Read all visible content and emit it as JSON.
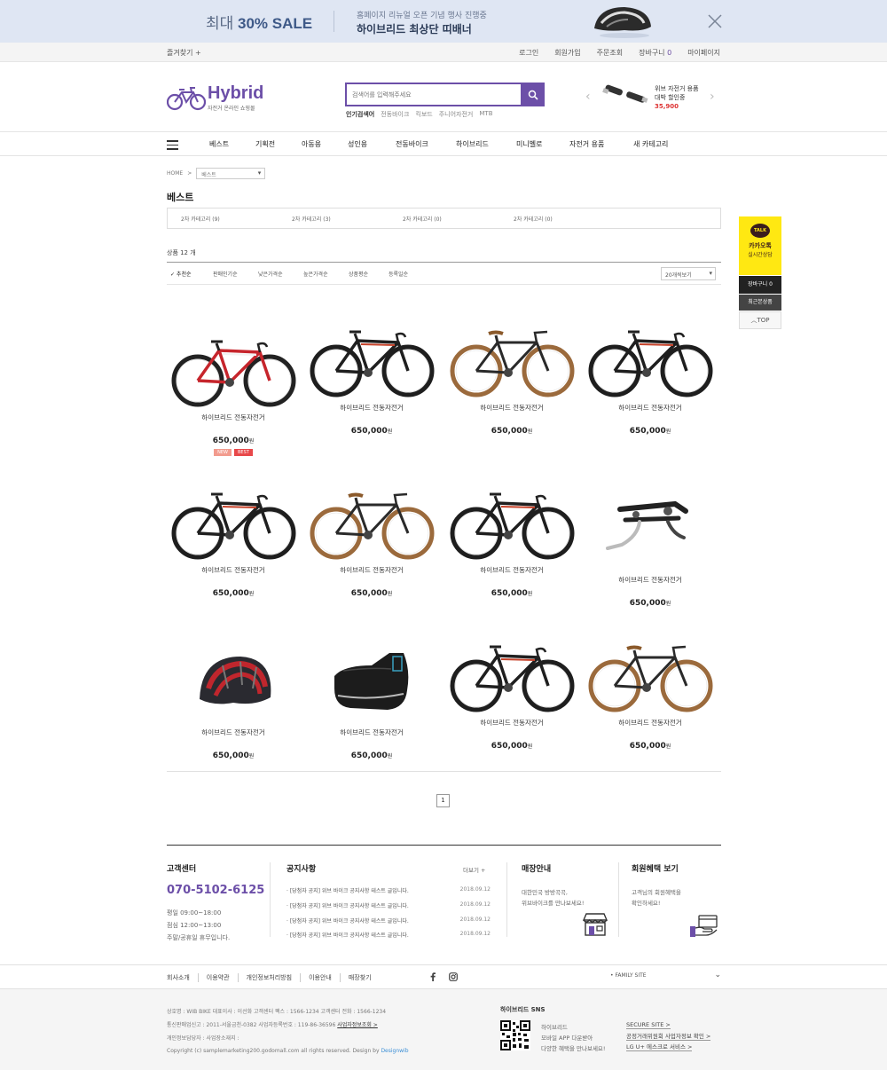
{
  "banner": {
    "sale_prefix": "최대",
    "sale_main": "30% SALE",
    "line1": "홈페이지 리뉴얼 오픈 기념 행사 진행중",
    "line2": "하이브리드 최상단 띠배너"
  },
  "util": {
    "favorite": "즐겨찾기 +",
    "links": [
      "로그인",
      "회원가입",
      "주문조회",
      "장바구니",
      "마이페이지"
    ],
    "cart_count": "0"
  },
  "header": {
    "logo_title": "Hybrid",
    "logo_sub": "자전거 온라인 쇼핑몰",
    "search_placeholder": "검색어를 입력해주세요",
    "popular_label": "인기검색어",
    "popular_items": [
      "전동바이크",
      "킥보드",
      "주니어자전거",
      "MTB"
    ],
    "ad_line1": "위브 자전거 용품",
    "ad_line2": "대박 할인중",
    "ad_price": "35,900"
  },
  "gnb": [
    "베스트",
    "기획전",
    "아동용",
    "성인용",
    "전동바이크",
    "하이브리드",
    "미니벨로",
    "자전거 용품",
    "새 카테고리"
  ],
  "breadcrumb": {
    "home": "HOME",
    "sep": ">",
    "current": "베스트"
  },
  "page_title": "베스트",
  "subcategories": [
    "2차 카테고리 (9)",
    "2차 카테고리 (3)",
    "2차 카테고리 (0)",
    "2차 카테고리 (0)"
  ],
  "product_count": "상품 12 개",
  "sort_options": [
    "✓ 추천순",
    "판매인기순",
    "낮은가격순",
    "높은가격순",
    "상품평순",
    "등록일순"
  ],
  "per_page": "20개씩보기",
  "products": [
    {
      "name": "하이브리드 전동자전거",
      "price": "650,000",
      "unit": "원",
      "image": "road-bike-red-white",
      "badges": [
        "NEW",
        "BEST"
      ]
    },
    {
      "name": "하이브리드 전동자전거",
      "price": "650,000",
      "unit": "원",
      "image": "road-bike-black-red"
    },
    {
      "name": "하이브리드 전동자전거",
      "price": "650,000",
      "unit": "원",
      "image": "city-bike-brown"
    },
    {
      "name": "하이브리드 전동자전거",
      "price": "650,000",
      "unit": "원",
      "image": "road-bike-black-red"
    },
    {
      "name": "하이브리드 전동자전거",
      "price": "650,000",
      "unit": "원",
      "image": "road-bike-black-red"
    },
    {
      "name": "하이브리드 전동자전거",
      "price": "650,000",
      "unit": "원",
      "image": "city-bike-brown"
    },
    {
      "name": "하이브리드 전동자전거",
      "price": "650,000",
      "unit": "원",
      "image": "road-bike-black-red"
    },
    {
      "name": "하이브리드 전동자전거",
      "price": "650,000",
      "unit": "원",
      "image": "aero-handlebar"
    },
    {
      "name": "하이브리드 전동자전거",
      "price": "650,000",
      "unit": "원",
      "image": "helmet"
    },
    {
      "name": "하이브리드 전동자전거",
      "price": "650,000",
      "unit": "원",
      "image": "saddle-bag"
    },
    {
      "name": "하이브리드 전동자전거",
      "price": "650,000",
      "unit": "원",
      "image": "road-bike-black-red"
    },
    {
      "name": "하이브리드 전동자전거",
      "price": "650,000",
      "unit": "원",
      "image": "city-bike-brown"
    }
  ],
  "pagination": {
    "current": "1"
  },
  "quick": {
    "kakao_badge": "TALK",
    "kakao_line1": "카카오톡",
    "kakao_line2": "실시간상담",
    "cart": "장바구니 0",
    "recent": "최근본상품",
    "top": "TOP"
  },
  "footer": {
    "cs_title": "고객센터",
    "cs_phone": "070-5102-6125",
    "cs_hours": [
      "평일 09:00~18:00",
      "점심 12:00~13:00",
      "주말/공휴일 휴무입니다."
    ],
    "notice_title": "공지사항",
    "notice_more": "더보기 +",
    "notices": [
      {
        "text": "· [당첨자 공지] 위브 바이크 공지사항 테스트 글입니다.",
        "date": "2018.09.12"
      },
      {
        "text": "· [당첨자 공지] 위브 바이크 공지사항 테스트 글입니다.",
        "date": "2018.09.12"
      },
      {
        "text": "· [당첨자 공지] 위브 바이크 공지사항 테스트 글입니다.",
        "date": "2018.09.12"
      },
      {
        "text": "· [당첨자 공지] 위브 바이크 공지사항 테스트 글입니다.",
        "date": "2018.09.12"
      }
    ],
    "store_title": "매장안내",
    "store_text": [
      "대한민국 방방곡곡,",
      "위브바이크를 만나보세요!"
    ],
    "benefit_title": "회원혜택 보기",
    "benefit_text": [
      "고객님의 회원혜택을",
      "확인하세요!"
    ],
    "links": [
      "회사소개",
      "이용약관",
      "개인정보처리방침",
      "이용안내",
      "매장찾기"
    ],
    "family_site": "FAMILY SITE",
    "address_lines": [
      "상호명 : WIB BIKE     대표이사 : 이선화     고객센터 팩스 : 1566-1234     고객센터 전화 : 1566-1234",
      "통신판매업신고 : 2011-서울금천-0382     사업자등록번호 : 119-86-36596",
      "개인정보담당자 :        사업장소재지 :",
      "Copyright (c) samplemarketing200.godomall.com all rights reserved. Design by"
    ],
    "biz_check": "사업자정보조회 >",
    "designer": "Designwib",
    "sns_title": "하이브리드 SNS",
    "sns_text": [
      "하이브리드",
      "모바일 APP 다운받아",
      "다양한 혜택을 만나보세요!"
    ],
    "secure_links": [
      "SECURE SITE >",
      "공정거래위원회 사업자정보 확인 >",
      "LG U+ 에스크로 서비스 >"
    ]
  }
}
